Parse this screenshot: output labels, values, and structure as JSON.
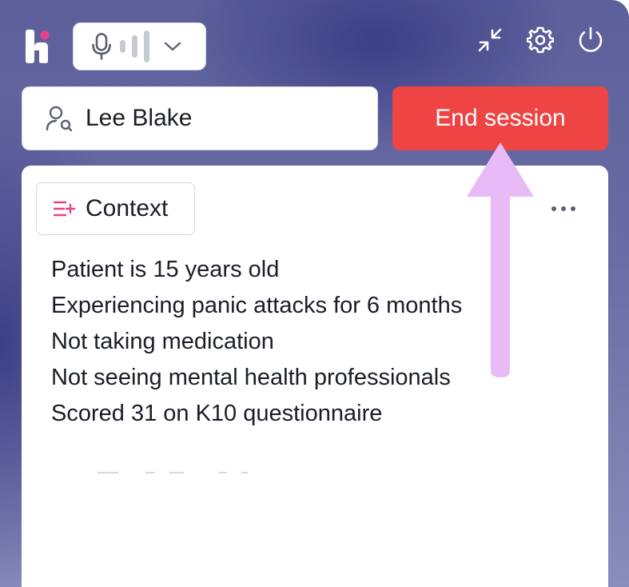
{
  "topbar": {
    "logo_icon": "brand-logo-icon",
    "mic_icon": "microphone-icon",
    "levels_icon": "audio-level-bars-icon",
    "dropdown_icon": "chevron-down-icon",
    "minimize_icon": "collapse-arrows-icon",
    "settings_icon": "gear-icon",
    "power_icon": "power-icon"
  },
  "patient": {
    "icon": "user-search-icon",
    "name": "Lee Blake"
  },
  "actions": {
    "end_session_label": "End session"
  },
  "context": {
    "tab_icon": "list-add-icon",
    "tab_label": "Context",
    "menu_icon": "more-horizontal-icon",
    "notes": [
      "Patient is 15 years old",
      "Experiencing panic attacks for 6 months",
      "Not taking medication",
      "Not seeing mental health professionals",
      "Scored 31 on K10 questionnaire"
    ]
  },
  "colors": {
    "accent_red": "#ef4444",
    "brand_pink": "#e8418a",
    "arrow_lavender": "#e9bbf6",
    "background_indigo": "#5c5f9a"
  }
}
